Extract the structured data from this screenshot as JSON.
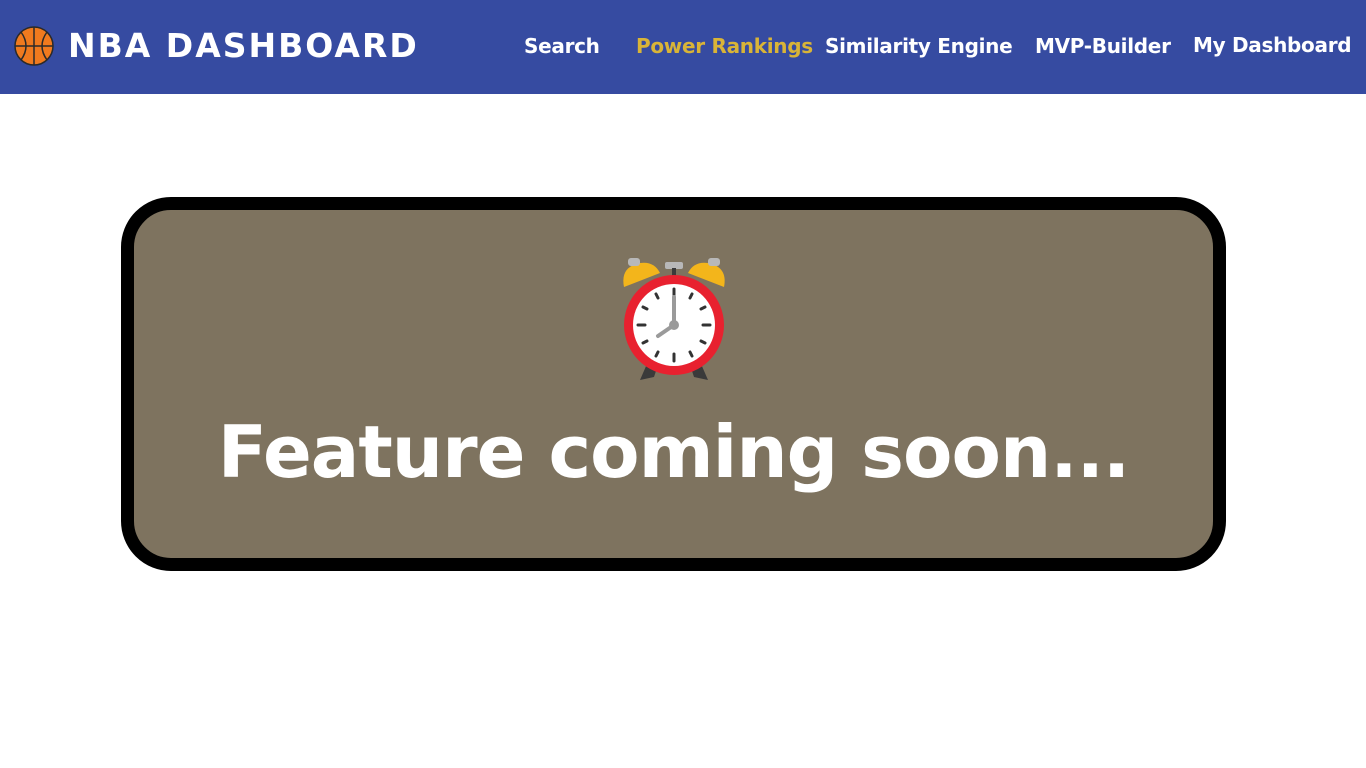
{
  "header": {
    "brand": "NBA DASHBOARD",
    "brand_icon": "basketball-icon",
    "background_color": "#364ba1",
    "nav": {
      "search": "Search",
      "power_rankings": "Power Rankings",
      "similarity_engine": "Similarity Engine",
      "mvp_builder": "MVP-Builder",
      "my_dashboard": "My Dashboard"
    },
    "active_nav_color": "#d9b437"
  },
  "notice": {
    "icon": "alarm-clock-icon",
    "message": "Feature coming soon...",
    "background_color": "#7e735f"
  }
}
